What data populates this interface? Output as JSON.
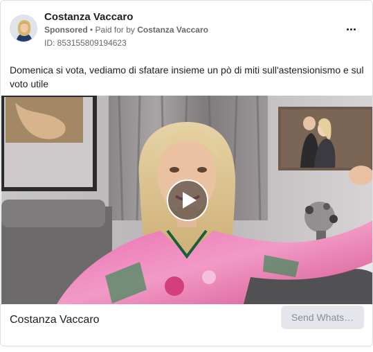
{
  "ad": {
    "page_name": "Costanza Vaccaro",
    "sponsored_label": "Sponsored",
    "bullet": " • ",
    "paid_for_label": "Paid for by ",
    "paid_for_name": "Costanza Vaccaro",
    "ad_id": "ID: 853155809194623",
    "body_text": "Domenica si vota, vediamo di sfatare insieme un pò di miti sull'astensionismo e sul voto utile",
    "footer_name": "Costanza Vaccaro",
    "cta_label": "Send Whats…"
  },
  "icons": {
    "more": "more-horizontal-icon",
    "play": "play-icon"
  },
  "colors": {
    "text_primary": "#1c1e21",
    "text_secondary": "#65676b",
    "cta_background": "#e4e6eb",
    "cta_text": "#8a8d91",
    "border": "#dddfe2"
  }
}
